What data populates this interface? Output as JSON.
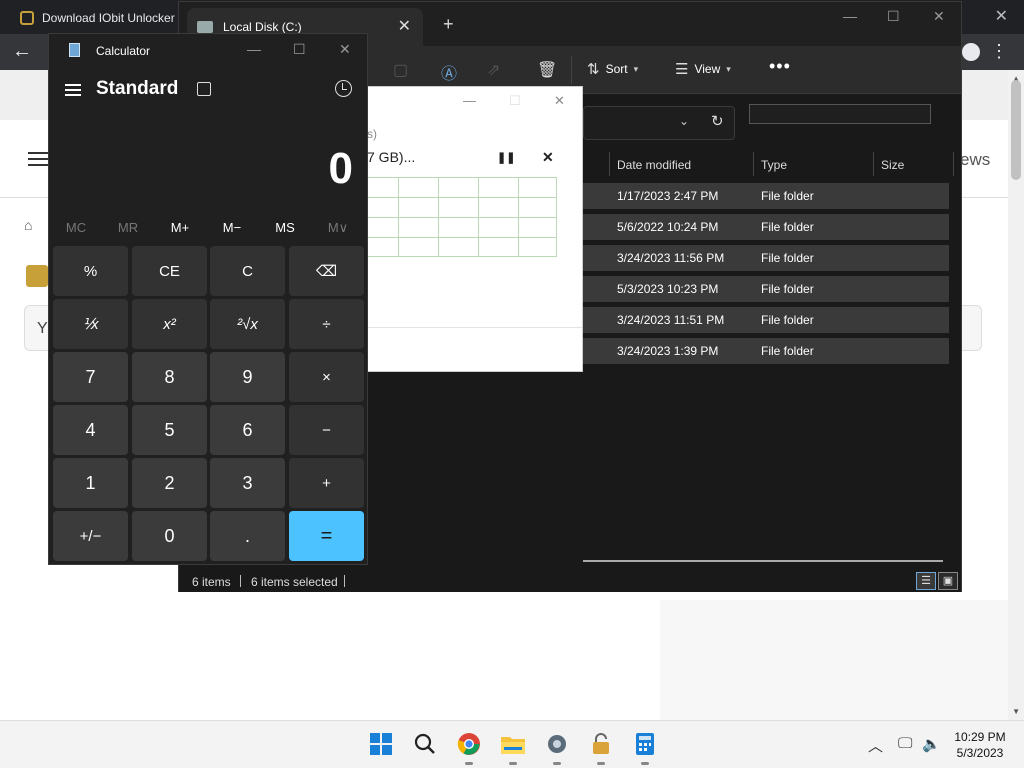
{
  "browser": {
    "tab_title": "Download IObit Unlocker",
    "page_partial_nav": "ews",
    "search_partial": "Y"
  },
  "explorer": {
    "tab_title": "Local Disk (C:)",
    "toolbar": {
      "sort_label": "Sort",
      "view_label": "View"
    },
    "columns": {
      "date_modified": "Date modified",
      "type": "Type",
      "size": "Size"
    },
    "rows": [
      {
        "date": "1/17/2023 2:47 PM",
        "type": "File folder"
      },
      {
        "date": "5/6/2022 10:24 PM",
        "type": "File folder"
      },
      {
        "date": "3/24/2023 11:56 PM",
        "type": "File folder"
      },
      {
        "date": "5/3/2023 10:23 PM",
        "type": "File folder"
      },
      {
        "date": "3/24/2023 11:51 PM",
        "type": "File folder"
      },
      {
        "date": "3/24/2023 1:39 PM",
        "type": "File folder"
      }
    ],
    "status": {
      "items": "6 items",
      "selected": "6 items selected"
    }
  },
  "copy_dialog": {
    "subtitle_partial": "s)",
    "main_partial": "7 GB)..."
  },
  "calculator": {
    "title": "Calculator",
    "mode": "Standard",
    "display": "0",
    "memory": [
      "MC",
      "MR",
      "M+",
      "M−",
      "MS",
      "M∨"
    ],
    "keys": [
      [
        "%",
        "CE",
        "C",
        "⌫"
      ],
      [
        "⅟x",
        "x²",
        "²√x",
        "÷"
      ],
      [
        "7",
        "8",
        "9",
        "×"
      ],
      [
        "4",
        "5",
        "6",
        "−"
      ],
      [
        "1",
        "2",
        "3",
        "+"
      ],
      [
        "+/−",
        "0",
        ".",
        "="
      ]
    ]
  },
  "taskbar": {
    "time": "10:29 PM",
    "date": "5/3/2023"
  },
  "colors": {
    "accent": "#4cc2ff",
    "explorer_bg": "#191919",
    "calc_bg": "#202020"
  }
}
